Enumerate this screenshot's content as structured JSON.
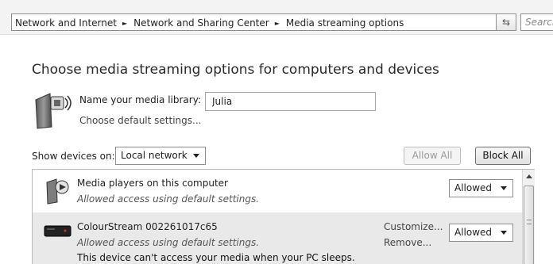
{
  "breadcrumb": {
    "items": [
      "Network and Internet",
      "Network and Sharing Center",
      "Media streaming options"
    ],
    "separator": "►"
  },
  "search": {
    "placeholder": "Search"
  },
  "page": {
    "title": "Choose media streaming options for computers and devices"
  },
  "library": {
    "label": "Name your media library:",
    "value": "Julia",
    "default_settings_link": "Choose default settings..."
  },
  "devices_filter": {
    "label": "Show devices on:",
    "selected": "Local network"
  },
  "actions": {
    "allow_all": "Allow All",
    "block_all": "Block All"
  },
  "devices": [
    {
      "name": "Media players on this computer",
      "status": "Allowed access using default settings.",
      "permission": "Allowed",
      "icon": "media-player-icon"
    },
    {
      "name": "ColourStream 002261017c65",
      "status": "Allowed access using default settings.",
      "warning": "This device can't access your media when your PC sleeps.",
      "customize": "Customize...",
      "remove": "Remove...",
      "permission": "Allowed",
      "icon": "media-device-icon"
    }
  ],
  "colors": {
    "accent": "#2a2a2a",
    "selected_row": "#e9e9e9"
  }
}
